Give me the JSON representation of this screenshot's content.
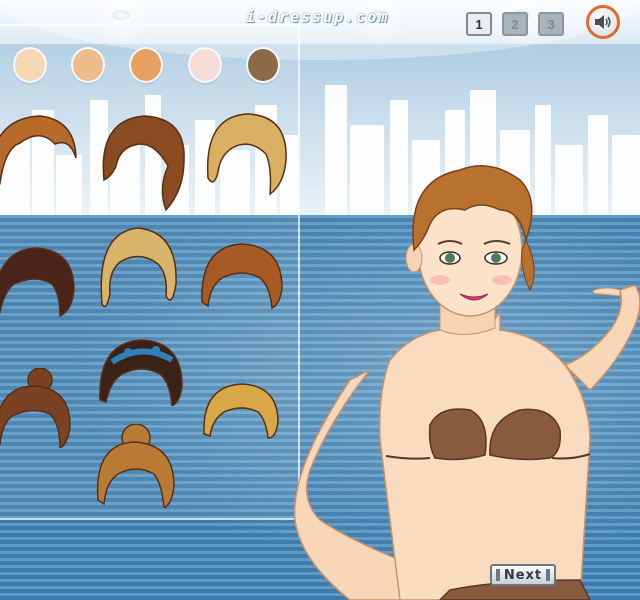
{
  "header": {
    "logo_text": "i-dressup.com",
    "pages": [
      {
        "label": "1",
        "active": true
      },
      {
        "label": "2",
        "active": false
      },
      {
        "label": "3",
        "active": false
      }
    ],
    "sound_icon": "speaker-icon"
  },
  "palette": {
    "swatch_colors": [
      "#f6d7b4",
      "#eebb8a",
      "#e6a060",
      "#f6dcd8",
      "#8a6a48"
    ],
    "accent": "#e36a2a"
  },
  "hair_options": [
    {
      "name": "hair-short-auburn",
      "color": "#b86a2a"
    },
    {
      "name": "hair-long-braid-brown",
      "color": "#8a4a22"
    },
    {
      "name": "hair-blonde-updo",
      "color": "#d9b063"
    },
    {
      "name": "hair-dark-bob-braid",
      "color": "#4a2418"
    },
    {
      "name": "hair-blonde-crown-braid",
      "color": "#d7b46a"
    },
    {
      "name": "hair-auburn-braided",
      "color": "#a85a24"
    },
    {
      "name": "hair-brown-bun",
      "color": "#7a4222"
    },
    {
      "name": "hair-dark-blue-ribbon",
      "color": "#3a2216"
    },
    {
      "name": "hair-golden-curls",
      "color": "#d8a848"
    },
    {
      "name": "hair-golden-brown-updo",
      "color": "#b87a34"
    }
  ],
  "footer": {
    "next_label": "Next"
  }
}
